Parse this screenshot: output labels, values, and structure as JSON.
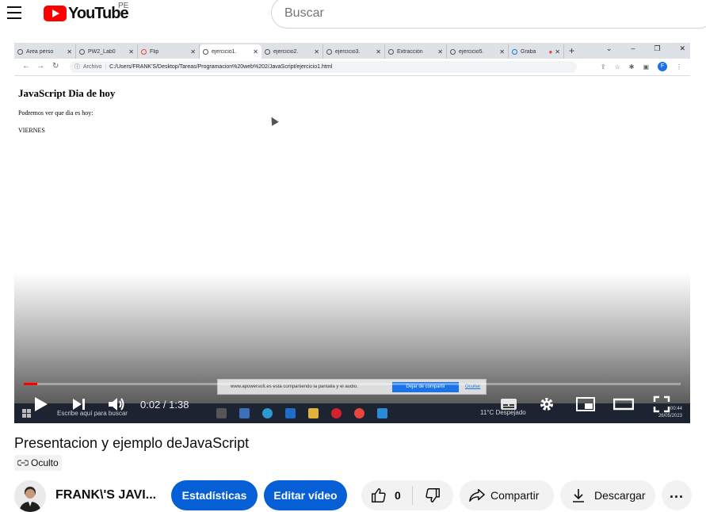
{
  "header": {
    "logo_text": "YouTube",
    "country_code": "PE",
    "search_placeholder": "Buscar"
  },
  "player": {
    "browser": {
      "tabs": [
        {
          "label": "Área perso",
          "active": false
        },
        {
          "label": "PW2_Lab0",
          "active": false
        },
        {
          "label": "Flip",
          "active": false
        },
        {
          "label": "ejercicio1.",
          "active": true
        },
        {
          "label": "ejercicio2.",
          "active": false
        },
        {
          "label": "ejercicio3.",
          "active": false
        },
        {
          "label": "Extracción",
          "active": false
        },
        {
          "label": "ejercicio5.",
          "active": false
        },
        {
          "label": "Graba",
          "active": false
        }
      ],
      "address_prefix": "Archivo",
      "address": "C:/Users/FRANK'S/Desktop/Tareas/Programacion%20web%202/JavaScript/ejercicio1.html",
      "profile_initial": "F"
    },
    "page": {
      "heading": "JavaScript Dia de hoy",
      "paragraph": "Podremos ver que dia es hoy:",
      "day": "VIERNES"
    },
    "share_notice": {
      "text": "www.apowersoft.es está compartiendo la pantalla y el audio.",
      "stop_label": "Dejar de compartir",
      "hide_label": "Ocultar"
    },
    "taskbar": {
      "search_text": "Escribe aquí para buscar",
      "weather": "11°C  Despejado",
      "time": "00:44",
      "date": "26/05/2023"
    },
    "time_current": "0:02",
    "time_total": "1:38",
    "time_display": "0:02 / 1:38",
    "progress_fraction": 0.02
  },
  "video": {
    "title": "Presentacion y ejemplo deJavaScript",
    "privacy": "Oculto"
  },
  "actions": {
    "channel_name": "FRANK\\'S JAVI...",
    "stats_label": "Estadísticas",
    "edit_label": "Editar vídeo",
    "like_count": "0",
    "share_label": "Compartir",
    "download_label": "Descargar"
  },
  "colors": {
    "brand_red": "#ff0000",
    "accent_blue": "#065fd4"
  }
}
